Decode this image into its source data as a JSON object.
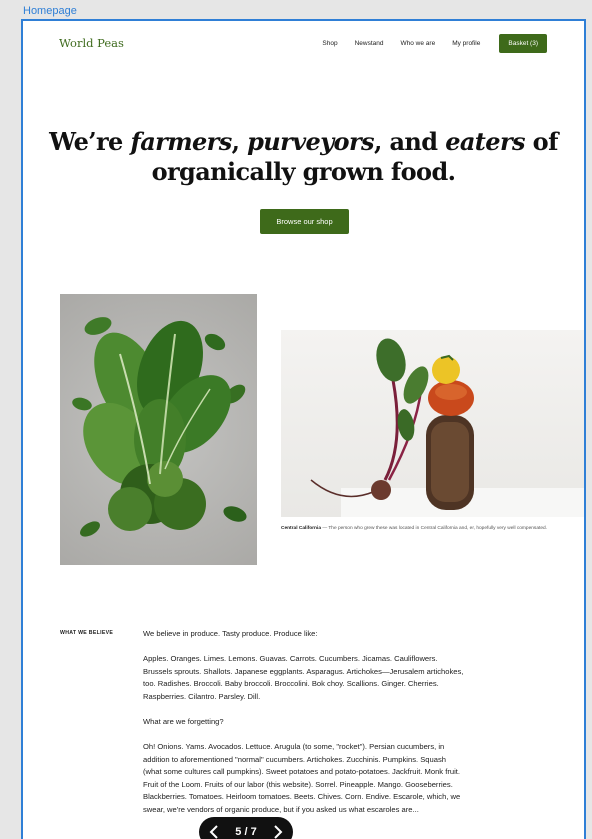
{
  "frame": {
    "label": "Homepage"
  },
  "nav": {
    "logo": "World Peas",
    "links": [
      "Shop",
      "Newstand",
      "Who we are",
      "My profile"
    ],
    "basket": "Basket (3)"
  },
  "hero": {
    "line1_a": "We’re ",
    "line1_b": "farmers",
    "line1_c": ", ",
    "line1_d": "purveyors",
    "line1_e": ", and ",
    "line1_f": "eaters",
    "line1_g": " of",
    "line2": "organically grown food.",
    "cta": "Browse our shop"
  },
  "caption": {
    "bold": "Central California",
    "text": " — The person who grew these was located in Central California and, er, hopefully very well compensated."
  },
  "believe": {
    "label": "WHAT WE BELIEVE",
    "p1": "We believe in produce. Tasty produce. Produce like:",
    "p2": "Apples. Oranges. Limes. Lemons. Guavas. Carrots. Cucumbers. Jicamas. Cauliflowers. Brussels sprouts. Shallots. Japanese eggplants. Asparagus. Artichokes—Jerusalem artichokes, too. Radishes. Broccoli. Baby broccoli. Broccolini. Bok choy. Scallions. Ginger. Cherries. Raspberries. Cilantro. Parsley. Dill.",
    "p3": "What are we forgetting?",
    "p4": "Oh! Onions. Yams. Avocados. Lettuce. Arugula (to some, \"rocket\"). Persian cucumbers, in addition to aforementioned \"normal\" cucumbers. Artichokes. Zucchinis. Pumpkins. Squash (what some cultures call pumpkins). Sweet potatoes and potato-potatoes. Jackfruit. Monk fruit. Fruit of the Loom. Fruits of our labor (this website). Sorrel. Pineapple. Mango. Gooseberries. Blackberries. Tomatoes. Heirloom tomatoes. Beets. Chives. Corn. Endive. Escarole, which, we swear, we're vendors of organic produce, but if you asked us what escaroles are..."
  },
  "pager": {
    "count": "5 / 7"
  },
  "colors": {
    "brand_green": "#3e6a1a",
    "frame_blue": "#2f7fd6"
  }
}
